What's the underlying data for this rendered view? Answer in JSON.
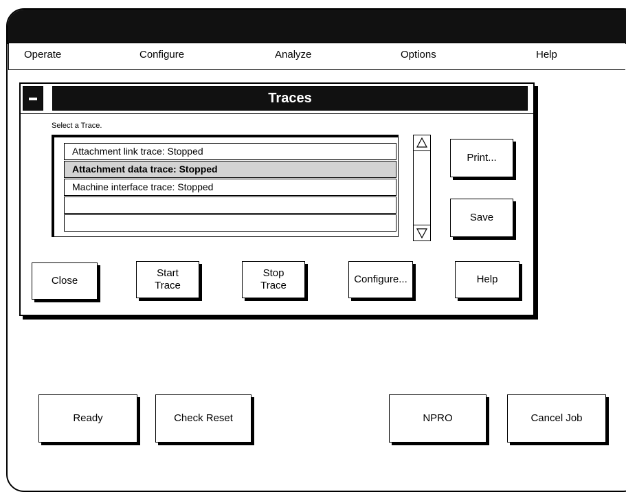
{
  "menubar": {
    "items": [
      "Operate",
      "Configure",
      "Analyze",
      "Options",
      "Help"
    ]
  },
  "dialog": {
    "title": "Traces",
    "instruction": "Select a Trace.",
    "list": {
      "rows": [
        "Attachment link trace: Stopped",
        "Attachment data trace: Stopped",
        "Machine interface trace: Stopped",
        "",
        ""
      ],
      "selected_index": 1
    },
    "side_buttons": {
      "print": "Print...",
      "save": "Save"
    },
    "buttons": {
      "close": "Close",
      "start_trace_1": "Start",
      "start_trace_2": "Trace",
      "stop_trace_1": "Stop",
      "stop_trace_2": "Trace",
      "configure": "Configure...",
      "help": "Help"
    }
  },
  "bottom_buttons": {
    "ready": "Ready",
    "check_reset": "Check Reset",
    "npro": "NPRO",
    "cancel_job": "Cancel Job"
  },
  "icons": {
    "dialog_menu": "minus-icon",
    "scroll_up": "triangle-up-icon",
    "scroll_down": "triangle-down-icon"
  }
}
